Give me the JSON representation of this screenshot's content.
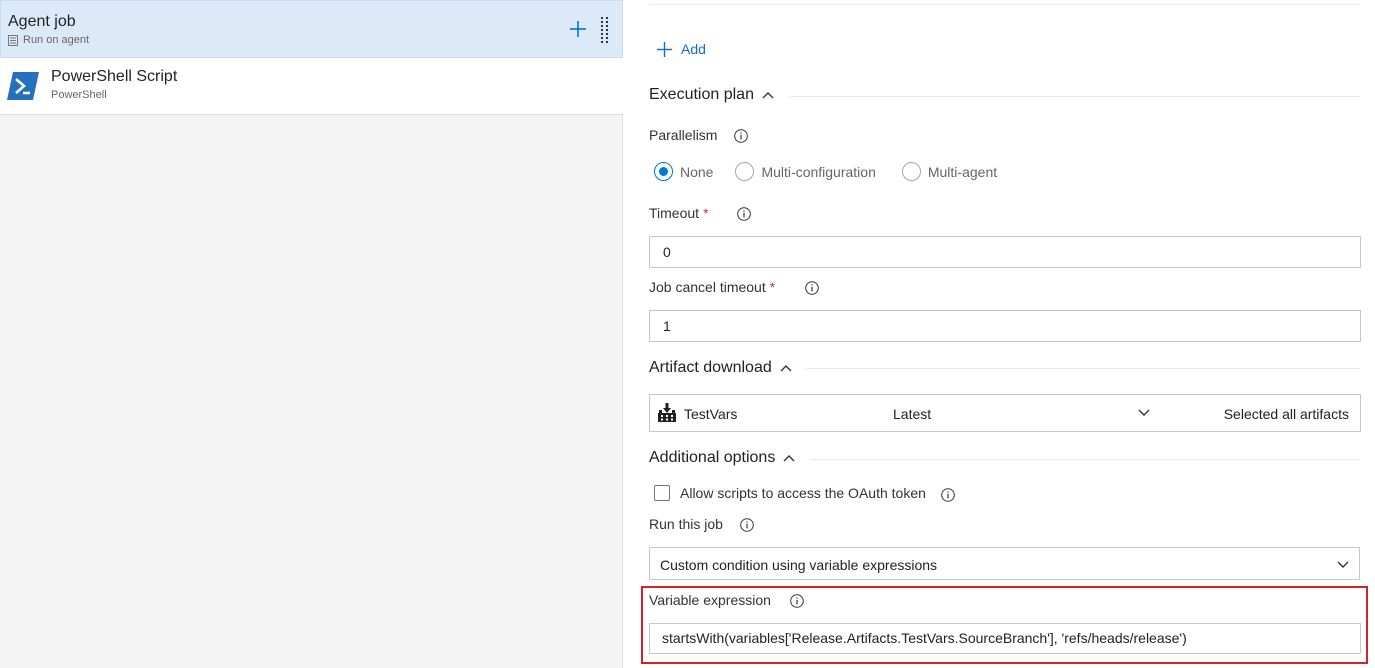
{
  "sidebar": {
    "job": {
      "title": "Agent job",
      "subtitle": "Run on agent"
    },
    "task": {
      "title": "PowerShell Script",
      "subtitle": "PowerShell"
    }
  },
  "toolbar": {
    "add_label": "Add"
  },
  "execution_plan": {
    "heading": "Execution plan",
    "parallelism_label": "Parallelism",
    "options": [
      {
        "label": "None",
        "checked": true
      },
      {
        "label": "Multi-configuration",
        "checked": false
      },
      {
        "label": "Multi-agent",
        "checked": false
      }
    ],
    "timeout_label": "Timeout",
    "timeout_value": "0",
    "cancel_timeout_label": "Job cancel timeout",
    "cancel_timeout_value": "1",
    "required_marker": "*"
  },
  "artifact_download": {
    "heading": "Artifact download",
    "artifact_name": "TestVars",
    "version": "Latest",
    "selection": "Selected all artifacts"
  },
  "additional_options": {
    "heading": "Additional options",
    "oauth_label": "Allow scripts to access the OAuth token",
    "oauth_checked": false,
    "run_job_label": "Run this job",
    "run_job_value": "Custom condition using variable expressions",
    "variable_expression_label": "Variable expression",
    "variable_expression_value": "startsWith(variables['Release.Artifacts.TestVars.SourceBranch'], 'refs/heads/release')"
  },
  "colors": {
    "accent": "#0078d4",
    "selected_row": "#dce9f8",
    "required": "#c4314b",
    "highlight": "#d0232b"
  }
}
